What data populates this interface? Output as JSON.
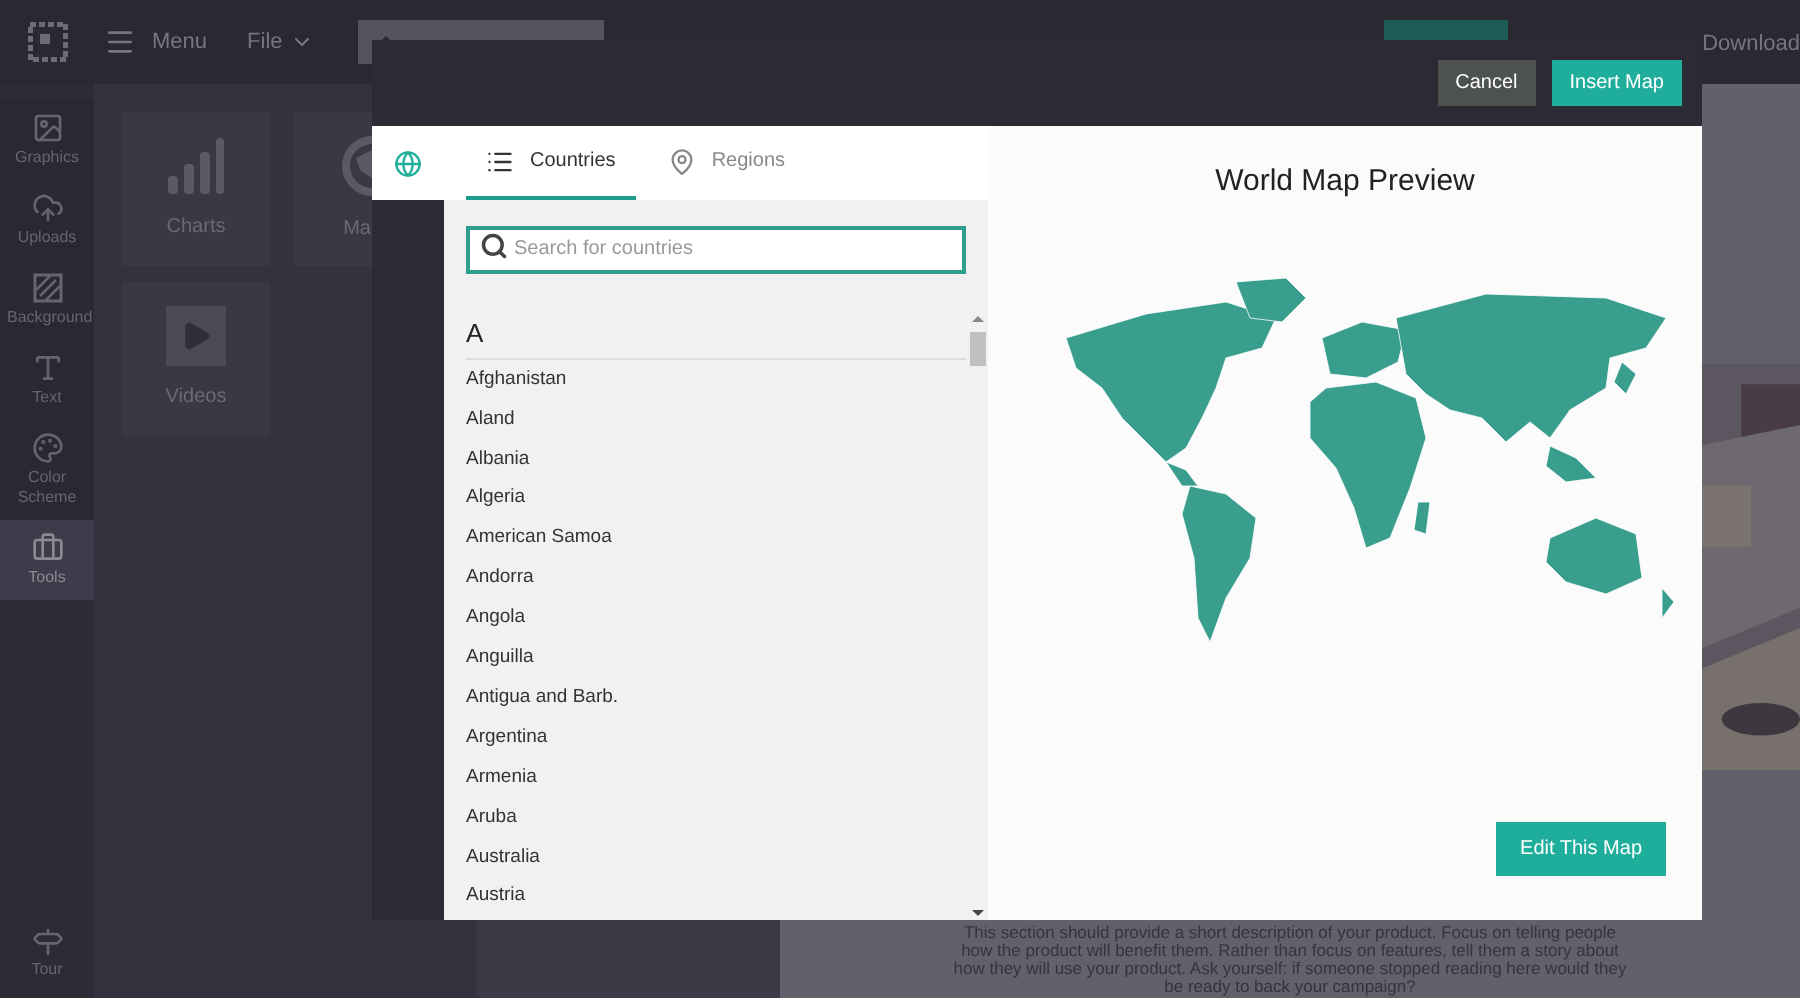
{
  "topbar": {
    "menu": "Menu",
    "file": "File",
    "download": "Download"
  },
  "sidebar": {
    "items": [
      {
        "label": "Graphics",
        "kind": "graphics",
        "selected": false
      },
      {
        "label": "Uploads",
        "kind": "uploads",
        "selected": false
      },
      {
        "label": "Background",
        "kind": "background",
        "selected": false
      },
      {
        "label": "Text",
        "kind": "text",
        "selected": false
      },
      {
        "label": "Color Scheme",
        "kind": "color",
        "selected": false
      },
      {
        "label": "Tools",
        "kind": "tools",
        "selected": true
      }
    ],
    "tour": "Tour"
  },
  "panel": {
    "tiles": [
      {
        "label": "Charts",
        "kind": "charts"
      },
      {
        "label": "Ma",
        "kind": "maps"
      },
      {
        "label": "Videos",
        "kind": "videos"
      }
    ]
  },
  "canvas": {
    "description": "This section should provide a short description of your product. Focus on telling people how the product will benefit them. Rather than focus on features, tell them a story about how they will use your product. Ask yourself: if someone stopped reading here would they be ready to back your campaign?"
  },
  "dialog": {
    "buttons": [
      {
        "label": "Cancel",
        "kind": "secondary"
      },
      {
        "label": "Insert Map",
        "kind": "primary"
      }
    ],
    "tabs": [
      {
        "label": "Countries",
        "kind": "list",
        "selected": true
      },
      {
        "label": "Regions",
        "kind": "pin",
        "selected": false
      }
    ],
    "search": {
      "placeholder": "Search for countries"
    },
    "letter": "A",
    "countries": [
      "Afghanistan",
      "Aland",
      "Albania",
      "Algeria",
      "American Samoa",
      "Andorra",
      "Angola",
      "Anguilla",
      "Antigua and Barb.",
      "Argentina",
      "Armenia",
      "Aruba",
      "Australia",
      "Austria"
    ],
    "preview_title": "World Map Preview",
    "edit_button": "Edit This Map"
  }
}
